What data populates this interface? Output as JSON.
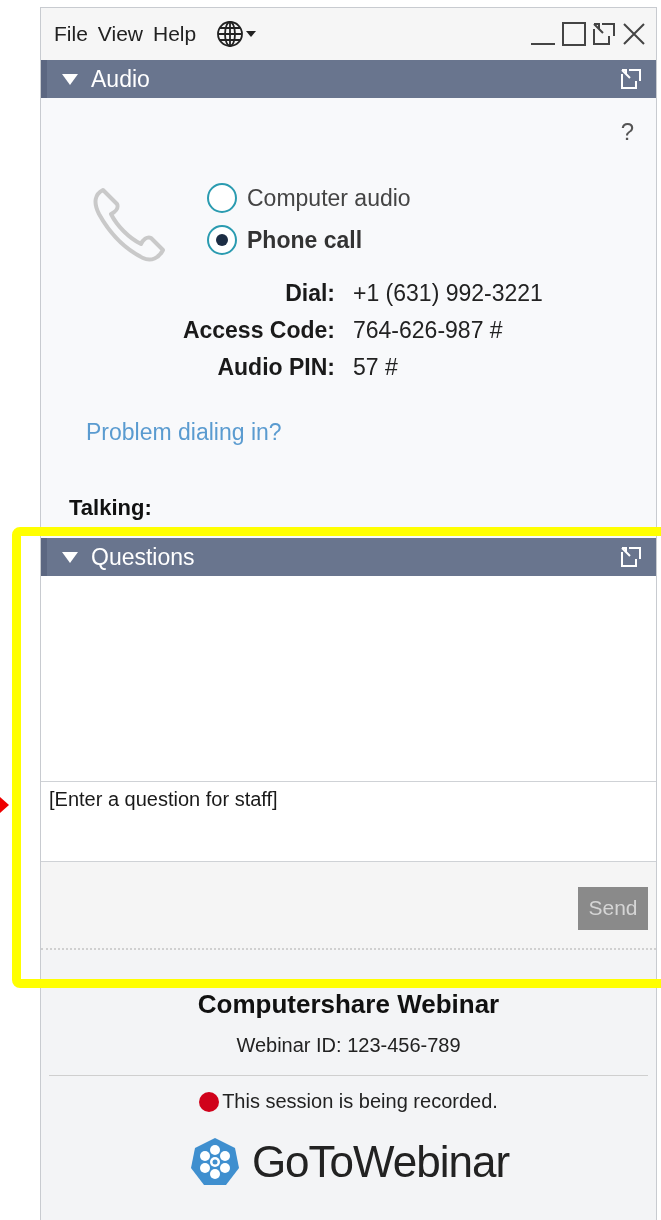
{
  "menu": [
    {
      "label": "File"
    },
    {
      "label": "View"
    },
    {
      "label": "Help"
    }
  ],
  "audio": {
    "header": {
      "title": "Audio",
      "expanded": true
    },
    "help": "?",
    "options": [
      {
        "label": "Computer audio",
        "selected": false
      },
      {
        "label": "Phone call",
        "selected": true
      }
    ],
    "details": [
      {
        "label": "Dial:",
        "value": "+1 (631) 992-3221"
      },
      {
        "label": "Access Code:",
        "value": "764-626-987 #"
      },
      {
        "label": "Audio PIN:",
        "value": "57 #"
      }
    ],
    "link": "Problem dialing in?",
    "talking": "Talking:"
  },
  "questions": {
    "header": {
      "title": "Questions",
      "expanded": true
    },
    "placeholder": "[Enter a question for staff]",
    "send": {
      "label": "Send",
      "disabled": true
    }
  },
  "footer": {
    "title": "Computershare Webinar",
    "webinar_id": "Webinar ID: 123-456-789",
    "recording": "This session is being recorded.",
    "logo": "**GoTo**Webinar"
  }
}
